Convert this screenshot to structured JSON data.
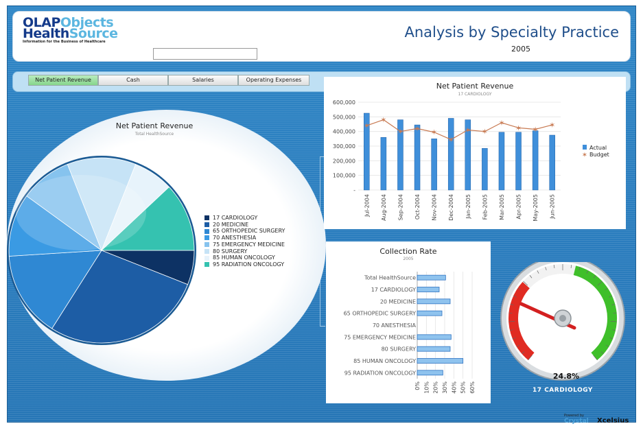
{
  "header": {
    "logo_line1_a": "OLAP",
    "logo_line1_b": "Objects",
    "logo_line2_a": "Health",
    "logo_line2_b": "Source",
    "logo_tagline": "Information for the Business of Healthcare",
    "title": "Analysis by Specialty Practice",
    "year": "2005",
    "search_value": ""
  },
  "tabs": [
    {
      "label": "Net Patient Revenue",
      "active": true
    },
    {
      "label": "Cash",
      "active": false
    },
    {
      "label": "Salaries",
      "active": false
    },
    {
      "label": "Operating Expenses",
      "active": false
    }
  ],
  "pie": {
    "title": "Net Patient Revenue",
    "subtitle": "Total HealthSource",
    "legend": [
      {
        "label": "17 CARDIOLOGY",
        "color": "#0d3264",
        "value": 6
      },
      {
        "label": "20 MEDICINE",
        "color": "#1d5da5",
        "value": 28
      },
      {
        "label": "65 ORTHOPEDIC SURGERY",
        "color": "#2f88d3",
        "value": 15
      },
      {
        "label": "70 ANESTHESIA",
        "color": "#3a9ae3",
        "value": 11
      },
      {
        "label": "75 EMERGENCY MEDICINE",
        "color": "#86c3ee",
        "value": 9
      },
      {
        "label": "80 SURGERY",
        "color": "#c6e3f6",
        "value": 12
      },
      {
        "label": "85 HUMAN ONCOLOGY",
        "color": "#e7f3fb",
        "value": 7
      },
      {
        "label": "95 RADIATION ONCOLOGY",
        "color": "#35c2b0",
        "value": 12
      }
    ]
  },
  "revenue_chart": {
    "title": "Net Patient Revenue",
    "subtitle": "17 CARDIOLOGY",
    "legend_actual": "Actual",
    "legend_budget": "Budget",
    "y_ticks": [
      "600,000",
      "500,000",
      "400,000",
      "300,000",
      "200,000",
      "100,000",
      "-"
    ]
  },
  "collection_chart": {
    "title": "Collection Rate",
    "subtitle": "2005",
    "x_ticks": [
      "0%",
      "10%",
      "20%",
      "30%",
      "40%",
      "50%",
      "60%"
    ]
  },
  "gauge": {
    "value": "24.8%",
    "label": "17 CARDIOLOGY"
  },
  "footer": {
    "powered_by": "Powered by",
    "brand_a": "Crystal",
    "brand_b": "Xcelsius"
  },
  "chart_data": [
    {
      "type": "bar",
      "title": "Net Patient Revenue",
      "subtitle": "17 CARDIOLOGY",
      "categories": [
        "Jul-2004",
        "Aug-2004",
        "Sep-2004",
        "Oct-2004",
        "Nov-2004",
        "Dec-2004",
        "Jan-2005",
        "Feb-2005",
        "Mar-2005",
        "Apr-2005",
        "May-2005",
        "Jun-2005"
      ],
      "series": [
        {
          "name": "Actual",
          "kind": "bar",
          "values": [
            525000,
            360000,
            480000,
            445000,
            350000,
            490000,
            480000,
            285000,
            395000,
            395000,
            405000,
            375000
          ]
        },
        {
          "name": "Budget",
          "kind": "line",
          "values": [
            440000,
            480000,
            400000,
            420000,
            395000,
            345000,
            410000,
            400000,
            460000,
            425000,
            415000,
            445000
          ]
        }
      ],
      "ylim": [
        0,
        600000
      ],
      "legend_position": "right"
    },
    {
      "type": "bar",
      "orientation": "horizontal",
      "title": "Collection Rate",
      "subtitle": "2005",
      "categories": [
        "Total HealthSource",
        "17 CARDIOLOGY",
        "20 MEDICINE",
        "65 ORTHOPEDIC SURGERY",
        "70 ANESTHESIA",
        "75 EMERGENCY MEDICINE",
        "80 SURGERY",
        "85 HUMAN ONCOLOGY",
        "95 RADIATION ONCOLOGY"
      ],
      "values": [
        31,
        24,
        36,
        27,
        0,
        37,
        36,
        50,
        28
      ],
      "xlim": [
        0,
        60
      ],
      "x_tick_format": "percent"
    },
    {
      "type": "gauge",
      "label": "17 CARDIOLOGY",
      "value": 24.8,
      "unit": "%"
    }
  ]
}
